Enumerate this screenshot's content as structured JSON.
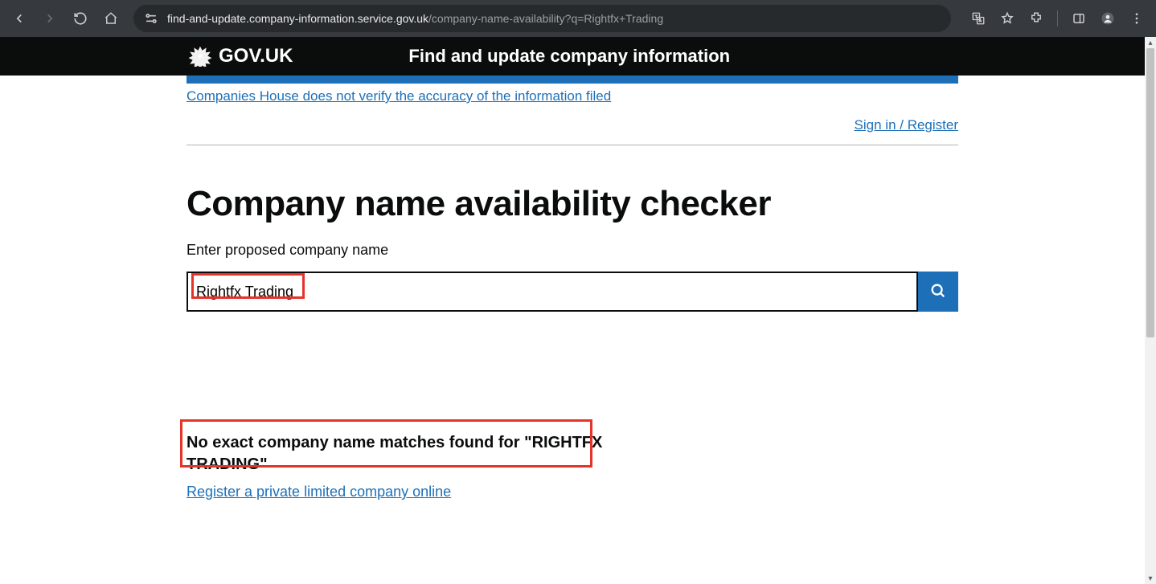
{
  "browser": {
    "url_host": "find-and-update.company-information.service.gov.uk",
    "url_path": "/company-name-availability?q=Rightfx+Trading"
  },
  "header": {
    "govuk": "GOV.UK",
    "service_name": "Find and update company information"
  },
  "notice": {
    "text": "Companies House does not verify the accuracy of the information filed"
  },
  "auth": {
    "signin_label": "Sign in / Register"
  },
  "page": {
    "title": "Company name availability checker",
    "field_label": "Enter proposed company name",
    "search_value": "Rightfx Trading"
  },
  "result": {
    "heading": "No exact company name matches found for \"RIGHTFX TRADING\"",
    "register_link": "Register a private limited company online"
  }
}
